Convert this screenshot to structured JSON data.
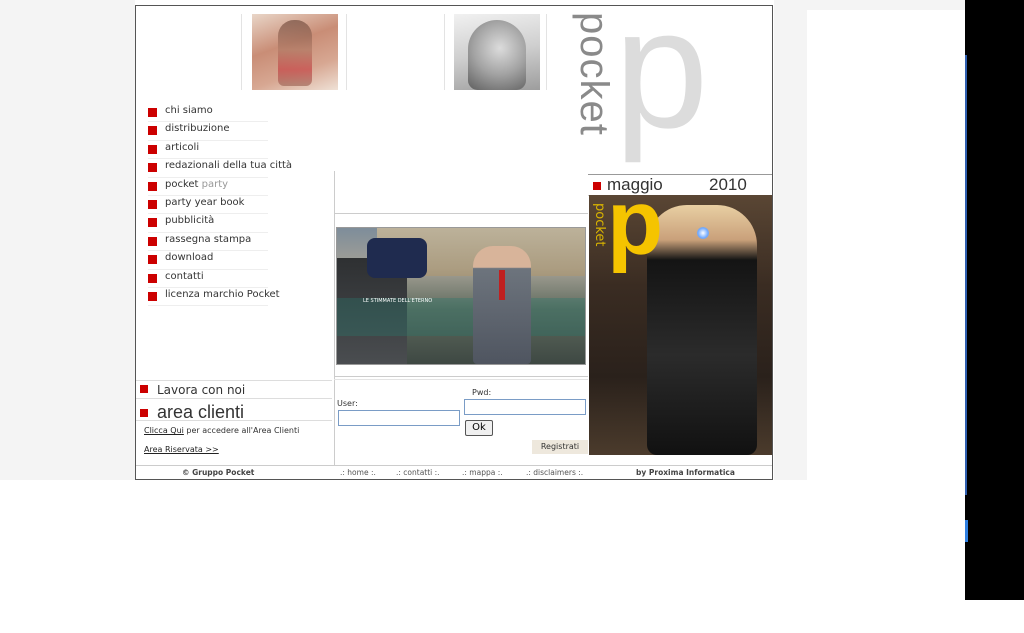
{
  "menu": {
    "items": [
      {
        "label": "chi siamo"
      },
      {
        "label": "distribuzione"
      },
      {
        "label": "articoli"
      },
      {
        "label": "redazionali della tua città"
      },
      {
        "label": "pocket",
        "extra": "party"
      },
      {
        "label": "party year book"
      },
      {
        "label": "pubblicità"
      },
      {
        "label": "rassegna stampa"
      },
      {
        "label": "download"
      },
      {
        "label": "contatti"
      },
      {
        "label": "licenza marchio Pocket"
      }
    ]
  },
  "header": {
    "vertical_brand": "pocket",
    "logo_letter": "p"
  },
  "main_photo": {
    "caption": "LE STIMMATE DELL'ETERNO"
  },
  "side": {
    "lavora": "Lavora con noi",
    "area": "area clienti",
    "clicca_link": "Clicca Qui",
    "clicca_rest": " per accedere all'Area Clienti",
    "area_riservata": "Area Riservata >>"
  },
  "login": {
    "user_label": "User:",
    "pwd_label": "Pwd:",
    "ok": "Ok",
    "register": "Registrati"
  },
  "magazine": {
    "month": "maggio",
    "year": "2010",
    "cover_letter": "p",
    "cover_vertical": "pocket"
  },
  "footer": {
    "copyright": "©  Gruppo Pocket",
    "links": [
      ".: home :.",
      ".: contatti :.",
      ".: mappa :.",
      ".: disclaimers :."
    ],
    "by": "by Proxima Informatica"
  },
  "colors": {
    "accent": "#cc0000",
    "logo_yellow": "#f5c400"
  }
}
